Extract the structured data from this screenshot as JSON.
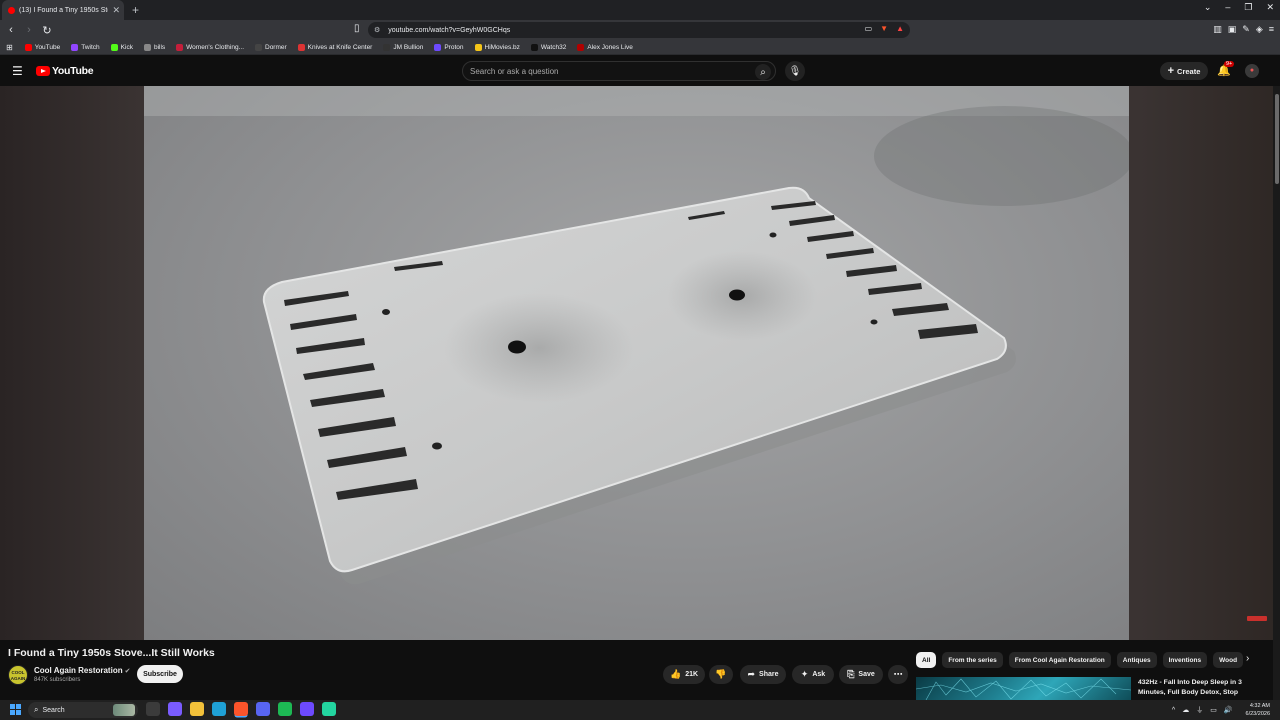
{
  "browser": {
    "tab_title": "(13) I Found a Tiny 1950s Stove...",
    "url": "youtube.com/watch?v=GeyhW0GCHqs",
    "bookmarks": [
      {
        "label": "YouTube",
        "color": "#ff0000"
      },
      {
        "label": "Twitch",
        "color": "#9146ff"
      },
      {
        "label": "Kick",
        "color": "#53fc18"
      },
      {
        "label": "bills",
        "color": "#888888"
      },
      {
        "label": "Women's Clothing...",
        "color": "#c41e3a"
      },
      {
        "label": "Dormer",
        "color": "#444444"
      },
      {
        "label": "Knives at Knife Center",
        "color": "#d33"
      },
      {
        "label": "JM Bullion",
        "color": "#333333"
      },
      {
        "label": "Proton",
        "color": "#6d4aff"
      },
      {
        "label": "HiMovies.bz",
        "color": "#f5c518"
      },
      {
        "label": "Watch32",
        "color": "#111111"
      },
      {
        "label": "Alex Jones Live",
        "color": "#b00000"
      }
    ]
  },
  "youtube": {
    "logo_text": "YouTube",
    "search_placeholder": "Search or ask a question",
    "create_label": "Create",
    "notification_badge": "9+",
    "video_title": "I Found a Tiny 1950s Stove...It Still Works",
    "channel_name": "Cool Again Restoration",
    "channel_avatar_text": "COOL AGAIN",
    "subscribers": "847K subscribers",
    "subscribe_label": "Subscribe",
    "likes": "21K",
    "share_label": "Share",
    "ask_label": "Ask",
    "save_label": "Save",
    "chips": [
      "All",
      "From the series",
      "From Cool Again Restoration",
      "Antiques",
      "Inventions",
      "Wood"
    ],
    "active_chip": "All",
    "recommended_title": "432Hz - Fall Into Deep Sleep in 3 Minutes, Full Body Detox, Stop"
  },
  "taskbar": {
    "search_label": "Search",
    "time": "4:32 AM",
    "date": "6/23/2026",
    "apps": [
      {
        "name": "task-view",
        "color": "#3b3b3b"
      },
      {
        "name": "copilot",
        "color": "#7a5cff"
      },
      {
        "name": "file-explorer",
        "color": "#f3c13a"
      },
      {
        "name": "edge",
        "color": "#1fa1d6"
      },
      {
        "name": "brave",
        "color": "#fb542b"
      },
      {
        "name": "discord",
        "color": "#5865f2"
      },
      {
        "name": "spotify",
        "color": "#1db954"
      },
      {
        "name": "proton-vpn",
        "color": "#6d4aff"
      },
      {
        "name": "app-green",
        "color": "#23d5a0"
      }
    ]
  },
  "colors": {
    "accent_red": "#ff0000",
    "background": "#0f0f0f"
  }
}
